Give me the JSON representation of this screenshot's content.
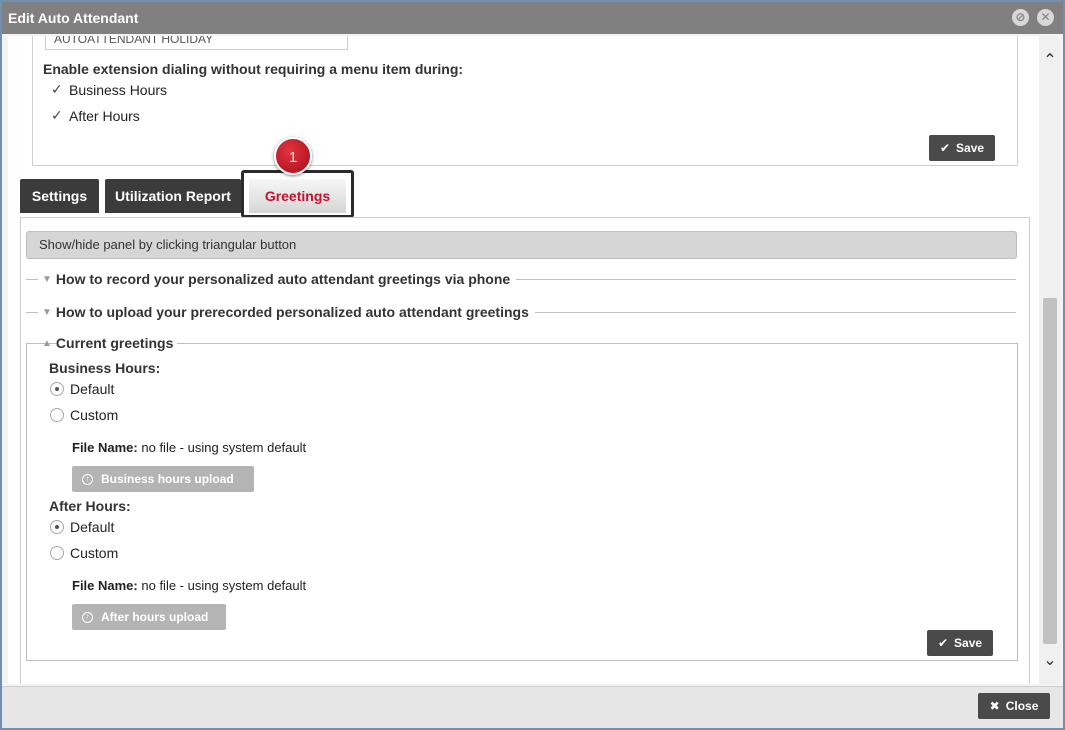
{
  "window": {
    "title": "Edit Auto Attendant"
  },
  "top_section": {
    "input_value": "AUTOATTENDANT HOLIDAY",
    "extension_dialing_label": "Enable extension dialing without requiring a menu item during:",
    "business_hours_label": "Business Hours",
    "after_hours_label": "After Hours",
    "business_hours_checked": true,
    "after_hours_checked": true,
    "save_label": "Save"
  },
  "tabs": [
    {
      "label": "Settings",
      "active": false
    },
    {
      "label": "Utilization Report",
      "active": false
    },
    {
      "label": "Greetings",
      "active": true
    }
  ],
  "step_badge": "1",
  "greetings": {
    "info_text": "Show/hide panel by clicking triangular button",
    "section_phone": "How to record your personalized auto attendant greetings via phone",
    "section_upload": "How to upload your prerecorded personalized auto attendant greetings",
    "section_current": "Current greetings",
    "business_hours": {
      "label": "Business Hours:",
      "default_label": "Default",
      "custom_label": "Custom",
      "selected": "Default",
      "file_name_label": "File Name:",
      "file_name_value": "no file - using system default",
      "upload_label": "Business hours upload"
    },
    "after_hours": {
      "label": "After Hours:",
      "default_label": "Default",
      "custom_label": "Custom",
      "selected": "Default",
      "file_name_label": "File Name:",
      "file_name_value": "no file - using system default",
      "upload_label": "After hours upload"
    },
    "save_label": "Save"
  },
  "footer": {
    "close_label": "Close"
  },
  "colors": {
    "titlebar": "#808080",
    "active_tab_text": "#c8102e",
    "badge": "#c8102e",
    "dark_button": "#4a4a4a"
  }
}
